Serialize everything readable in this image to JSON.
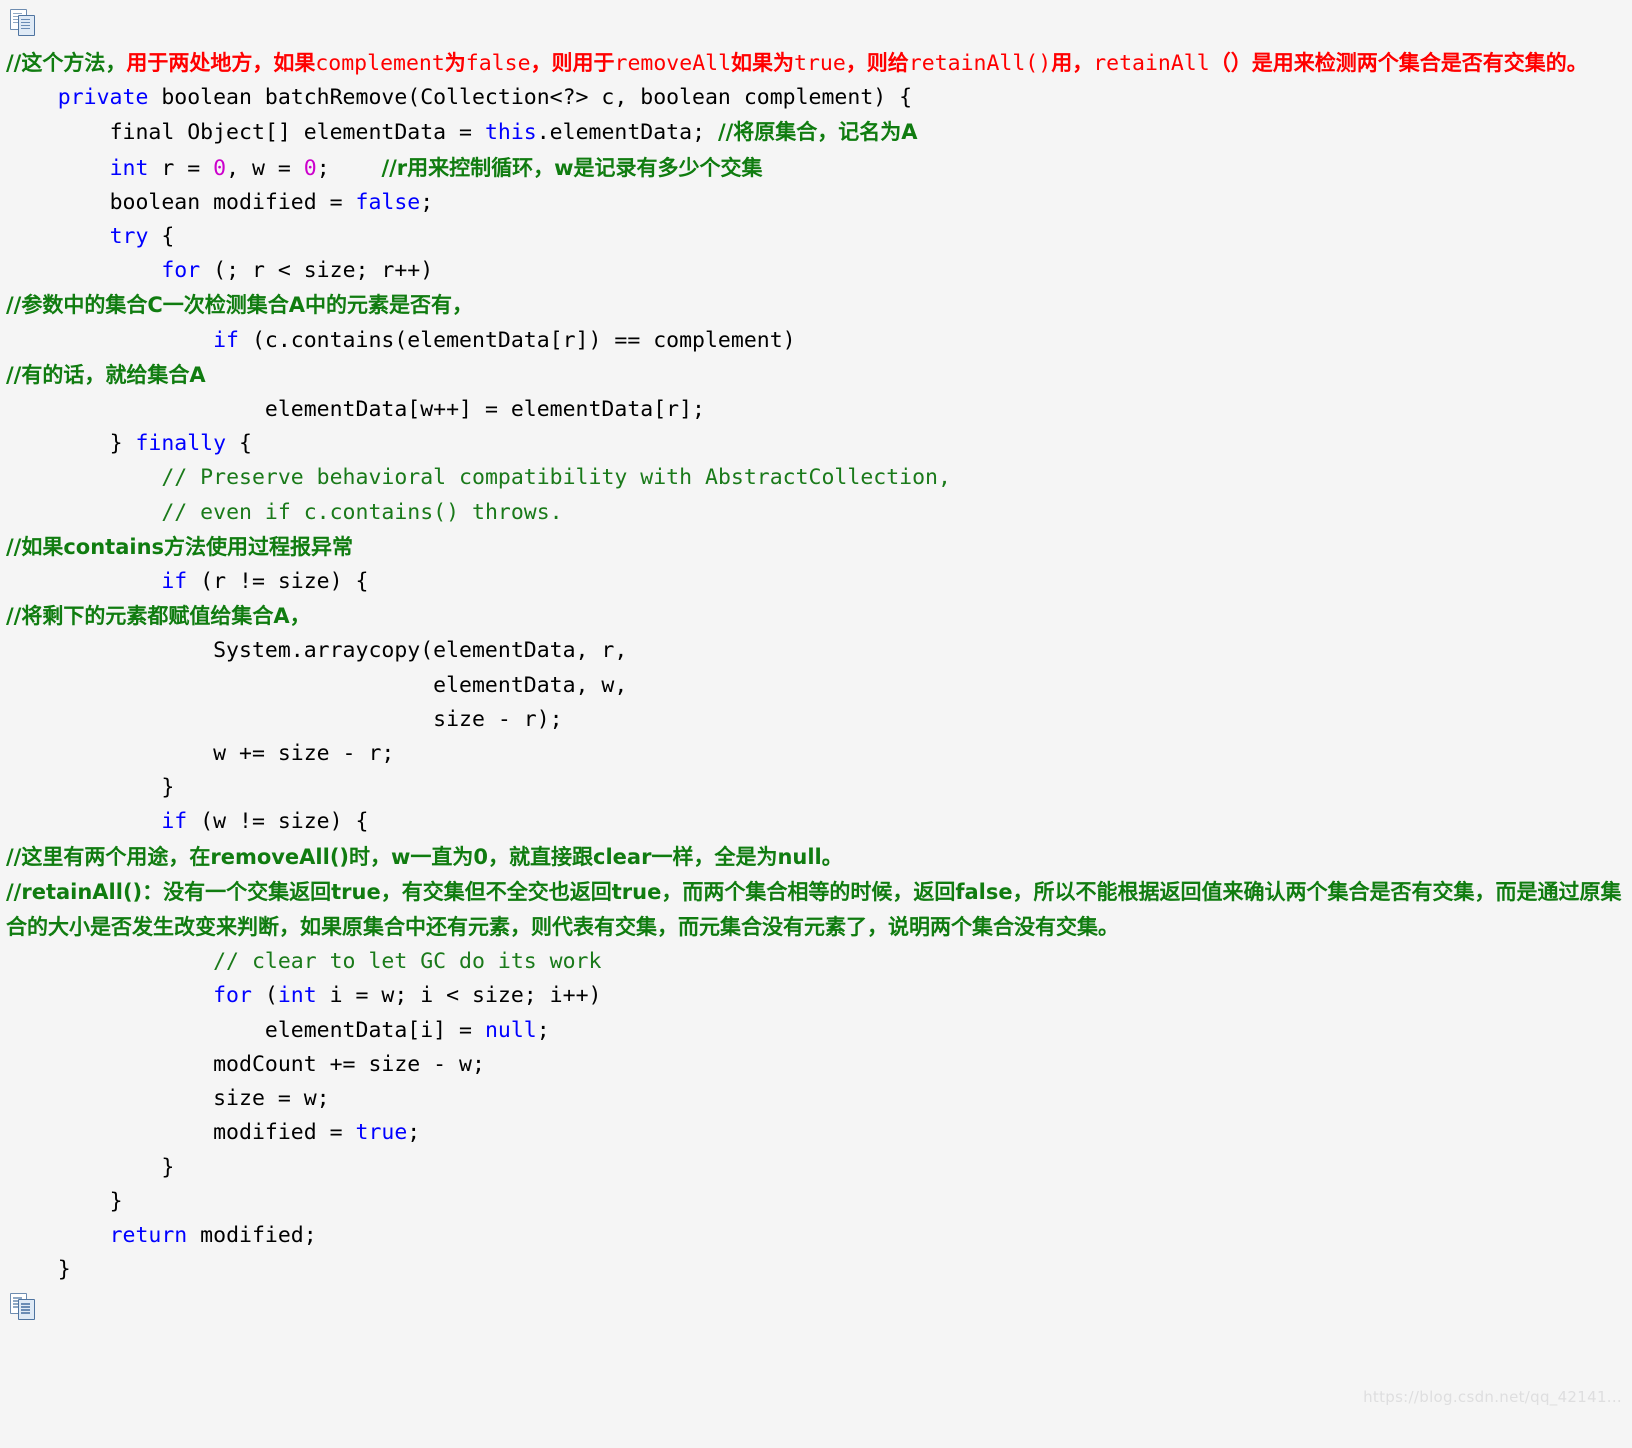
{
  "page": {
    "background_color": "#f5f5f5",
    "watermark": "https://blog.csdn.net/qq_42141...",
    "icons": {
      "top_copy": "copy-icon",
      "bottom_copy": "copy-icon"
    }
  },
  "colors": {
    "keyword": "#0000ff",
    "number": "#cc00cc",
    "comment_green": "#1a7a1a",
    "comment_cn_green": "#107c10",
    "comment_red": "#ff0000",
    "plain": "#000000",
    "watermark": "#dededf"
  },
  "code": {
    "language": "java",
    "method_name": "batchRemove",
    "lines": [
      {
        "id": "l1",
        "tokens": [
          {
            "cls": "grn-cn",
            "t": "//这个方法，"
          },
          {
            "cls": "red-cn",
            "t": "用于两处地方，如果"
          },
          {
            "cls": "red",
            "t": "complement"
          },
          {
            "cls": "red-cn",
            "t": "为"
          },
          {
            "cls": "red",
            "t": "false"
          },
          {
            "cls": "red-cn",
            "t": "，则用于"
          },
          {
            "cls": "red",
            "t": "removeAll"
          },
          {
            "cls": "red-cn",
            "t": "如果为"
          },
          {
            "cls": "red",
            "t": "true"
          },
          {
            "cls": "red-cn",
            "t": "，则给"
          },
          {
            "cls": "red",
            "t": "retainAll()"
          },
          {
            "cls": "red-cn",
            "t": "用，"
          },
          {
            "cls": "red",
            "t": "retainAll"
          },
          {
            "cls": "red-cn",
            "t": "（）是用来检测两个集合是否有交集的。"
          }
        ]
      },
      {
        "id": "l2",
        "tokens": [
          {
            "cls": "plain",
            "t": "    "
          },
          {
            "cls": "kw",
            "t": "private"
          },
          {
            "cls": "plain",
            "t": " boolean batchRemove(Collection<?> c, boolean complement) {"
          }
        ]
      },
      {
        "id": "l3",
        "tokens": [
          {
            "cls": "plain",
            "t": "        final Object[] elementData = "
          },
          {
            "cls": "kw",
            "t": "this"
          },
          {
            "cls": "plain",
            "t": ".elementData; "
          },
          {
            "cls": "cmt-cn",
            "t": "//将原集合，记名为A"
          }
        ]
      },
      {
        "id": "l4",
        "tokens": [
          {
            "cls": "plain",
            "t": "        "
          },
          {
            "cls": "kw",
            "t": "int"
          },
          {
            "cls": "plain",
            "t": " r = "
          },
          {
            "cls": "num",
            "t": "0"
          },
          {
            "cls": "plain",
            "t": ", w = "
          },
          {
            "cls": "num",
            "t": "0"
          },
          {
            "cls": "plain",
            "t": ";    "
          },
          {
            "cls": "cmt-cn",
            "t": "//r用来控制循环，w是记录有多少个交集"
          }
        ]
      },
      {
        "id": "l5",
        "tokens": [
          {
            "cls": "plain",
            "t": "        boolean modified = "
          },
          {
            "cls": "kw",
            "t": "false"
          },
          {
            "cls": "plain",
            "t": ";"
          }
        ]
      },
      {
        "id": "l6",
        "tokens": [
          {
            "cls": "plain",
            "t": "        "
          },
          {
            "cls": "kw",
            "t": "try"
          },
          {
            "cls": "plain",
            "t": " {"
          }
        ]
      },
      {
        "id": "l7",
        "tokens": [
          {
            "cls": "plain",
            "t": "            "
          },
          {
            "cls": "kw",
            "t": "for"
          },
          {
            "cls": "plain",
            "t": " (; r < size; r++)"
          }
        ]
      },
      {
        "id": "l8",
        "tokens": [
          {
            "cls": "cmt-cn",
            "t": "//参数中的集合C一次检测集合A中的元素是否有，"
          }
        ]
      },
      {
        "id": "l9",
        "tokens": [
          {
            "cls": "plain",
            "t": "                "
          },
          {
            "cls": "kw",
            "t": "if"
          },
          {
            "cls": "plain",
            "t": " (c.contains(elementData[r]) == complement)"
          }
        ]
      },
      {
        "id": "l10",
        "tokens": [
          {
            "cls": "cmt-cn",
            "t": "//有的话，就给集合A"
          }
        ]
      },
      {
        "id": "l11",
        "tokens": [
          {
            "cls": "plain",
            "t": "                    elementData[w++] = elementData[r];"
          }
        ]
      },
      {
        "id": "l12",
        "tokens": [
          {
            "cls": "plain",
            "t": "        } "
          },
          {
            "cls": "kw",
            "t": "finally"
          },
          {
            "cls": "plain",
            "t": " {"
          }
        ]
      },
      {
        "id": "l13",
        "tokens": [
          {
            "cls": "plain",
            "t": "            "
          },
          {
            "cls": "cmt",
            "t": "// Preserve behavioral compatibility with AbstractCollection,"
          }
        ]
      },
      {
        "id": "l14",
        "tokens": [
          {
            "cls": "plain",
            "t": "            "
          },
          {
            "cls": "cmt",
            "t": "// even if c.contains() throws."
          }
        ]
      },
      {
        "id": "l15",
        "tokens": [
          {
            "cls": "cmt-cn",
            "t": "//如果contains方法使用过程报异常"
          }
        ]
      },
      {
        "id": "l16",
        "tokens": [
          {
            "cls": "plain",
            "t": "            "
          },
          {
            "cls": "kw",
            "t": "if"
          },
          {
            "cls": "plain",
            "t": " (r != size) {"
          }
        ]
      },
      {
        "id": "l17",
        "tokens": [
          {
            "cls": "cmt-cn",
            "t": "//将剩下的元素都赋值给集合A，"
          }
        ]
      },
      {
        "id": "l18",
        "tokens": [
          {
            "cls": "plain",
            "t": "                System.arraycopy(elementData, r,"
          }
        ]
      },
      {
        "id": "l19",
        "tokens": [
          {
            "cls": "plain",
            "t": "                                 elementData, w,"
          }
        ]
      },
      {
        "id": "l20",
        "tokens": [
          {
            "cls": "plain",
            "t": "                                 size - r);"
          }
        ]
      },
      {
        "id": "l21",
        "tokens": [
          {
            "cls": "plain",
            "t": "                w += size - r;"
          }
        ]
      },
      {
        "id": "l22",
        "tokens": [
          {
            "cls": "plain",
            "t": "            }"
          }
        ]
      },
      {
        "id": "l23",
        "tokens": [
          {
            "cls": "plain",
            "t": "            "
          },
          {
            "cls": "kw",
            "t": "if"
          },
          {
            "cls": "plain",
            "t": " (w != size) {"
          }
        ]
      },
      {
        "id": "l24",
        "tokens": [
          {
            "cls": "grn-cn",
            "t": "//这里有两个用途，在removeAll()时，w一直为0，就直接跟clear一样，全是为null。"
          }
        ]
      },
      {
        "id": "l25",
        "tokens": [
          {
            "cls": "grn-cn",
            "t": "//retainAll()：没有一个交集返回true，有交集但不全交也返回true，而两个集合相等的时候，返回false，所以不能根据返回值来确认两个集合是否有交集，而是通过原集合的大小是否发生改变来判断，如果原集合中还有元素，则代表有交集，而元集合没有元素了，说明两个集合没有交集。"
          }
        ]
      },
      {
        "id": "l26",
        "tokens": [
          {
            "cls": "plain",
            "t": "                "
          },
          {
            "cls": "cmt",
            "t": "// clear to let GC do its work"
          }
        ]
      },
      {
        "id": "l27",
        "tokens": [
          {
            "cls": "plain",
            "t": "                "
          },
          {
            "cls": "kw",
            "t": "for"
          },
          {
            "cls": "plain",
            "t": " ("
          },
          {
            "cls": "kw",
            "t": "int"
          },
          {
            "cls": "plain",
            "t": " i = w; i < size; i++)"
          }
        ]
      },
      {
        "id": "l28",
        "tokens": [
          {
            "cls": "plain",
            "t": "                    elementData[i] = "
          },
          {
            "cls": "kw",
            "t": "null"
          },
          {
            "cls": "plain",
            "t": ";"
          }
        ]
      },
      {
        "id": "l29",
        "tokens": [
          {
            "cls": "plain",
            "t": "                modCount += size - w;"
          }
        ]
      },
      {
        "id": "l30",
        "tokens": [
          {
            "cls": "plain",
            "t": "                size = w;"
          }
        ]
      },
      {
        "id": "l31",
        "tokens": [
          {
            "cls": "plain",
            "t": "                modified = "
          },
          {
            "cls": "kw",
            "t": "true"
          },
          {
            "cls": "plain",
            "t": ";"
          }
        ]
      },
      {
        "id": "l32",
        "tokens": [
          {
            "cls": "plain",
            "t": "            }"
          }
        ]
      },
      {
        "id": "l33",
        "tokens": [
          {
            "cls": "plain",
            "t": "        }"
          }
        ]
      },
      {
        "id": "l34",
        "tokens": [
          {
            "cls": "plain",
            "t": "        "
          },
          {
            "cls": "kw",
            "t": "return"
          },
          {
            "cls": "plain",
            "t": " modified;"
          }
        ]
      },
      {
        "id": "l35",
        "tokens": [
          {
            "cls": "plain",
            "t": "    }"
          }
        ]
      }
    ]
  }
}
